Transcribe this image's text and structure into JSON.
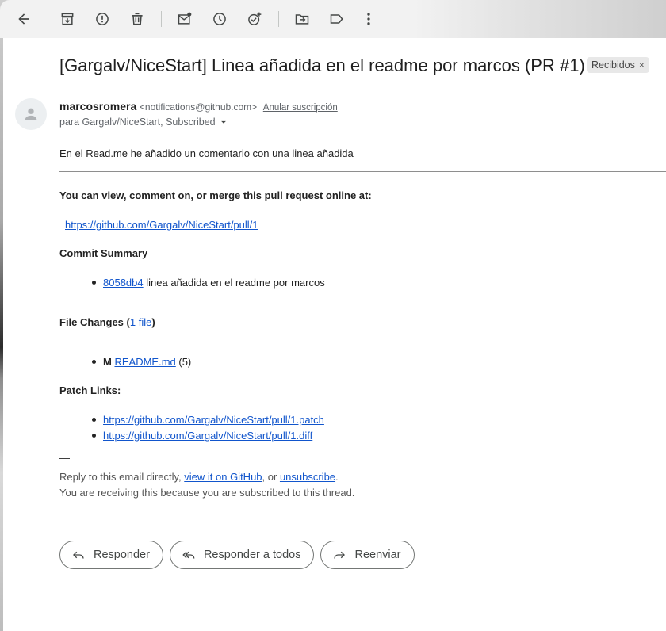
{
  "toolbar": {
    "icons": [
      "arrow-back-icon",
      "archive-icon",
      "report-spam-icon",
      "delete-icon",
      "mark-unread-icon",
      "snooze-icon",
      "add-task-icon",
      "move-to-icon",
      "label-icon",
      "more-vert-icon"
    ]
  },
  "email": {
    "subject": "[Gargalv/NiceStart] Linea añadida en el readme por marcos (PR #1)",
    "label": "Recibidos",
    "sender_name": "marcosromera",
    "sender_email": "<notifications@github.com>",
    "unsubscribe_top": "Anular suscripción",
    "to": "para Gargalv/NiceStart, Subscribed",
    "intro": "En el Read.me he añadido un comentario con una linea añadida",
    "view_heading": "You can view, comment on, or merge this pull request online at:",
    "pr_url": "https://github.com/Gargalv/NiceStart/pull/1",
    "commit_heading": "Commit Summary",
    "commit_hash": "8058db4",
    "commit_msg": " linea añadida en el readme por marcos",
    "file_changes_heading": "File Changes (",
    "file_changes_link": "1 file",
    "file_changes_close": ")",
    "file_status": "M",
    "file_name": "README.md",
    "file_count": " (5)",
    "patch_heading": "Patch Links:",
    "patch_url": "https://github.com/Gargalv/NiceStart/pull/1.patch",
    "diff_url": "https://github.com/Gargalv/NiceStart/pull/1.diff",
    "sig_dash": "—",
    "reply_prefix": "Reply to this email directly, ",
    "view_github": "view it on GitHub",
    "reply_mid": ", or ",
    "unsubscribe": "unsubscribe",
    "reply_end": ".",
    "receiving": "You are receiving this because you are subscribed to this thread."
  },
  "actions": {
    "reply": "Responder",
    "reply_all": "Responder a todos",
    "forward": "Reenviar"
  }
}
